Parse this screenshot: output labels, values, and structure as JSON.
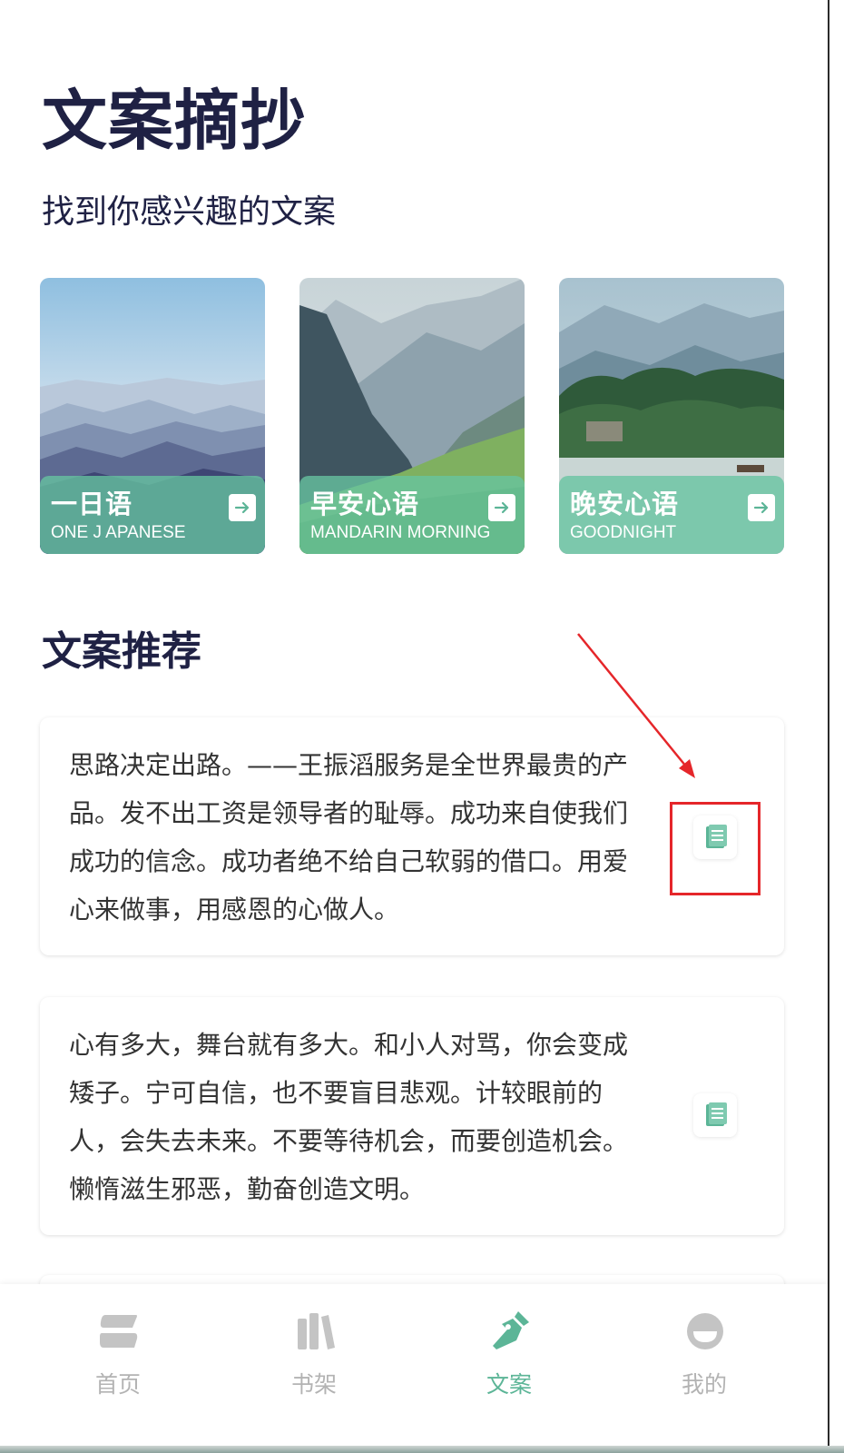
{
  "header": {
    "title": "文案摘抄",
    "subtitle": "找到你感兴趣的文案"
  },
  "categories": [
    {
      "title": "一日语",
      "subtitle": "ONE J APANESE",
      "icon": "arrow-right-icon"
    },
    {
      "title": "早安心语",
      "subtitle": "MANDARIN MORNING",
      "icon": "arrow-right-icon"
    },
    {
      "title": "晚安心语",
      "subtitle": "GOODNIGHT",
      "icon": "arrow-right-icon"
    }
  ],
  "recommend": {
    "title": "文案推荐",
    "quotes": [
      {
        "text": "思路决定出路。——王振滔服务是全世界最贵的产品。发不出工资是领导者的耻辱。成功来自使我们成功的信念。成功者绝不给自己软弱的借口。用爱心来做事，用感恩的心做人。",
        "icon": "copy-icon"
      },
      {
        "text": "心有多大，舞台就有多大。和小人对骂，你会变成矮子。宁可自信，也不要盲目悲观。计较眼前的人，会失去未来。不要等待机会，而要创造机会。懒惰滋生邪恶，勤奋创造文明。",
        "icon": "copy-icon"
      }
    ]
  },
  "tabbar": {
    "items": [
      {
        "label": "首页",
        "icon": "home-icon",
        "active": false
      },
      {
        "label": "书架",
        "icon": "bookshelf-icon",
        "active": false
      },
      {
        "label": "文案",
        "icon": "pen-nib-icon",
        "active": true
      },
      {
        "label": "我的",
        "icon": "profile-icon",
        "active": false
      }
    ]
  },
  "colors": {
    "title": "#1f2144",
    "accent": "#5cb597",
    "inactive_tab": "#b3b3b3",
    "annotation": "#e5262a"
  }
}
